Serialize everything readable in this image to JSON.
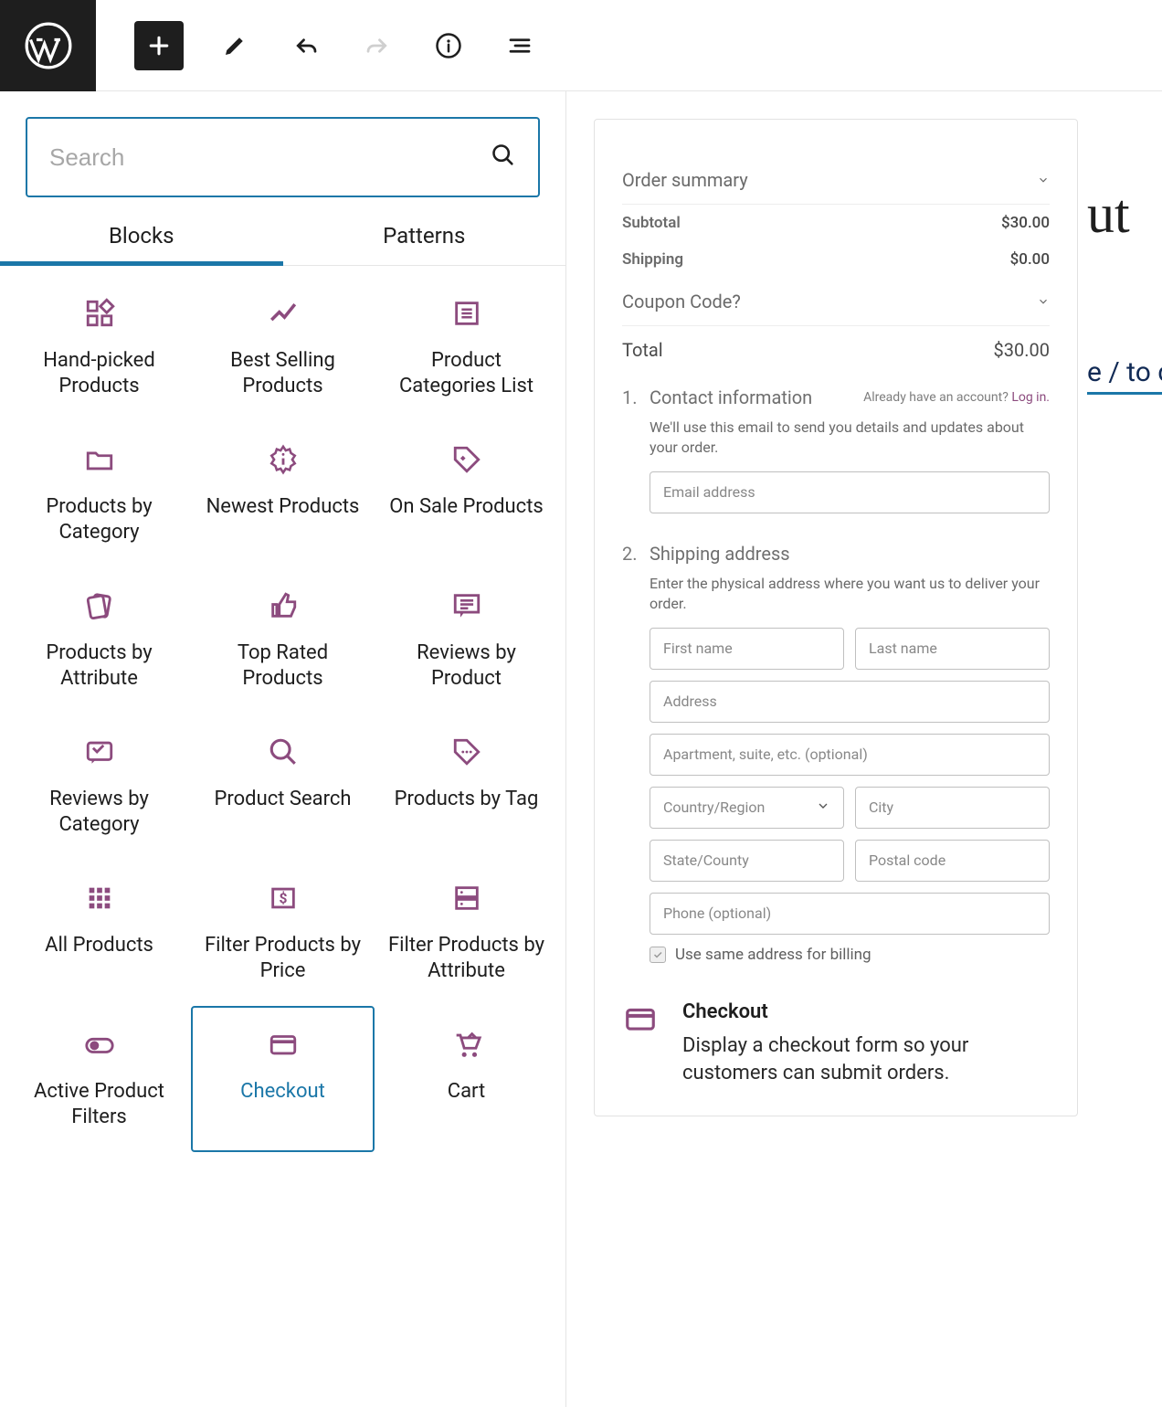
{
  "toolbar": {},
  "search": {
    "placeholder": "Search"
  },
  "tabs": {
    "blocks": "Blocks",
    "patterns": "Patterns"
  },
  "blocks": [
    {
      "label": "Hand-picked Products",
      "icon": "grid-custom"
    },
    {
      "label": "Best Selling Products",
      "icon": "trend"
    },
    {
      "label": "Product Categories List",
      "icon": "list"
    },
    {
      "label": "Products by Category",
      "icon": "folder"
    },
    {
      "label": "Newest Products",
      "icon": "badge-new"
    },
    {
      "label": "On Sale Products",
      "icon": "tag"
    },
    {
      "label": "Products by Attribute",
      "icon": "cards"
    },
    {
      "label": "Top Rated Products",
      "icon": "thumbs-up"
    },
    {
      "label": "Reviews by Product",
      "icon": "review-box"
    },
    {
      "label": "Reviews by Category",
      "icon": "review-folder"
    },
    {
      "label": "Product Search",
      "icon": "search"
    },
    {
      "label": "Products by Tag",
      "icon": "tag-more"
    },
    {
      "label": "All Products",
      "icon": "dots-grid"
    },
    {
      "label": "Filter Products by Price",
      "icon": "price-box"
    },
    {
      "label": "Filter Products by Attribute",
      "icon": "server"
    },
    {
      "label": "Active Product Filters",
      "icon": "toggle"
    },
    {
      "label": "Checkout",
      "icon": "credit-card",
      "selected": true
    },
    {
      "label": "Cart",
      "icon": "cart"
    }
  ],
  "preview": {
    "summary_title": "Order summary",
    "subtotal_label": "Subtotal",
    "subtotal_value": "$30.00",
    "shipping_label": "Shipping",
    "shipping_value": "$0.00",
    "coupon_label": "Coupon Code?",
    "total_label": "Total",
    "total_value": "$30.00",
    "step1_num": "1.",
    "step1_title": "Contact information",
    "step1_account_prefix": "Already have an account? ",
    "step1_login": "Log in.",
    "step1_sub": "We'll use this email to send you details and updates about your order.",
    "email_placeholder": "Email address",
    "step2_num": "2.",
    "step2_title": "Shipping address",
    "step2_sub": "Enter the physical address where you want us to deliver your order.",
    "first_name": "First name",
    "last_name": "Last name",
    "address": "Address",
    "apartment": "Apartment, suite, etc. (optional)",
    "country": "Country/Region",
    "city": "City",
    "state": "State/County",
    "postal": "Postal code",
    "phone": "Phone (optional)",
    "same_billing": "Use same address for billing",
    "desc_title": "Checkout",
    "desc_text": "Display a checkout form so your customers can submit orders."
  },
  "bg_text_1": "ut",
  "bg_text_2": "e / to c"
}
